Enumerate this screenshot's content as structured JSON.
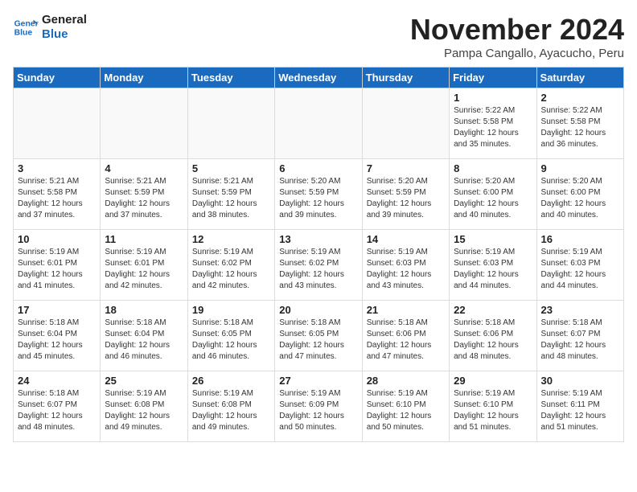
{
  "header": {
    "logo_line1": "General",
    "logo_line2": "Blue",
    "month_title": "November 2024",
    "subtitle": "Pampa Cangallo, Ayacucho, Peru"
  },
  "weekdays": [
    "Sunday",
    "Monday",
    "Tuesday",
    "Wednesday",
    "Thursday",
    "Friday",
    "Saturday"
  ],
  "weeks": [
    [
      {
        "day": "",
        "info": ""
      },
      {
        "day": "",
        "info": ""
      },
      {
        "day": "",
        "info": ""
      },
      {
        "day": "",
        "info": ""
      },
      {
        "day": "",
        "info": ""
      },
      {
        "day": "1",
        "info": "Sunrise: 5:22 AM\nSunset: 5:58 PM\nDaylight: 12 hours\nand 35 minutes."
      },
      {
        "day": "2",
        "info": "Sunrise: 5:22 AM\nSunset: 5:58 PM\nDaylight: 12 hours\nand 36 minutes."
      }
    ],
    [
      {
        "day": "3",
        "info": "Sunrise: 5:21 AM\nSunset: 5:58 PM\nDaylight: 12 hours\nand 37 minutes."
      },
      {
        "day": "4",
        "info": "Sunrise: 5:21 AM\nSunset: 5:59 PM\nDaylight: 12 hours\nand 37 minutes."
      },
      {
        "day": "5",
        "info": "Sunrise: 5:21 AM\nSunset: 5:59 PM\nDaylight: 12 hours\nand 38 minutes."
      },
      {
        "day": "6",
        "info": "Sunrise: 5:20 AM\nSunset: 5:59 PM\nDaylight: 12 hours\nand 39 minutes."
      },
      {
        "day": "7",
        "info": "Sunrise: 5:20 AM\nSunset: 5:59 PM\nDaylight: 12 hours\nand 39 minutes."
      },
      {
        "day": "8",
        "info": "Sunrise: 5:20 AM\nSunset: 6:00 PM\nDaylight: 12 hours\nand 40 minutes."
      },
      {
        "day": "9",
        "info": "Sunrise: 5:20 AM\nSunset: 6:00 PM\nDaylight: 12 hours\nand 40 minutes."
      }
    ],
    [
      {
        "day": "10",
        "info": "Sunrise: 5:19 AM\nSunset: 6:01 PM\nDaylight: 12 hours\nand 41 minutes."
      },
      {
        "day": "11",
        "info": "Sunrise: 5:19 AM\nSunset: 6:01 PM\nDaylight: 12 hours\nand 42 minutes."
      },
      {
        "day": "12",
        "info": "Sunrise: 5:19 AM\nSunset: 6:02 PM\nDaylight: 12 hours\nand 42 minutes."
      },
      {
        "day": "13",
        "info": "Sunrise: 5:19 AM\nSunset: 6:02 PM\nDaylight: 12 hours\nand 43 minutes."
      },
      {
        "day": "14",
        "info": "Sunrise: 5:19 AM\nSunset: 6:03 PM\nDaylight: 12 hours\nand 43 minutes."
      },
      {
        "day": "15",
        "info": "Sunrise: 5:19 AM\nSunset: 6:03 PM\nDaylight: 12 hours\nand 44 minutes."
      },
      {
        "day": "16",
        "info": "Sunrise: 5:19 AM\nSunset: 6:03 PM\nDaylight: 12 hours\nand 44 minutes."
      }
    ],
    [
      {
        "day": "17",
        "info": "Sunrise: 5:18 AM\nSunset: 6:04 PM\nDaylight: 12 hours\nand 45 minutes."
      },
      {
        "day": "18",
        "info": "Sunrise: 5:18 AM\nSunset: 6:04 PM\nDaylight: 12 hours\nand 46 minutes."
      },
      {
        "day": "19",
        "info": "Sunrise: 5:18 AM\nSunset: 6:05 PM\nDaylight: 12 hours\nand 46 minutes."
      },
      {
        "day": "20",
        "info": "Sunrise: 5:18 AM\nSunset: 6:05 PM\nDaylight: 12 hours\nand 47 minutes."
      },
      {
        "day": "21",
        "info": "Sunrise: 5:18 AM\nSunset: 6:06 PM\nDaylight: 12 hours\nand 47 minutes."
      },
      {
        "day": "22",
        "info": "Sunrise: 5:18 AM\nSunset: 6:06 PM\nDaylight: 12 hours\nand 48 minutes."
      },
      {
        "day": "23",
        "info": "Sunrise: 5:18 AM\nSunset: 6:07 PM\nDaylight: 12 hours\nand 48 minutes."
      }
    ],
    [
      {
        "day": "24",
        "info": "Sunrise: 5:18 AM\nSunset: 6:07 PM\nDaylight: 12 hours\nand 48 minutes."
      },
      {
        "day": "25",
        "info": "Sunrise: 5:19 AM\nSunset: 6:08 PM\nDaylight: 12 hours\nand 49 minutes."
      },
      {
        "day": "26",
        "info": "Sunrise: 5:19 AM\nSunset: 6:08 PM\nDaylight: 12 hours\nand 49 minutes."
      },
      {
        "day": "27",
        "info": "Sunrise: 5:19 AM\nSunset: 6:09 PM\nDaylight: 12 hours\nand 50 minutes."
      },
      {
        "day": "28",
        "info": "Sunrise: 5:19 AM\nSunset: 6:10 PM\nDaylight: 12 hours\nand 50 minutes."
      },
      {
        "day": "29",
        "info": "Sunrise: 5:19 AM\nSunset: 6:10 PM\nDaylight: 12 hours\nand 51 minutes."
      },
      {
        "day": "30",
        "info": "Sunrise: 5:19 AM\nSunset: 6:11 PM\nDaylight: 12 hours\nand 51 minutes."
      }
    ]
  ]
}
